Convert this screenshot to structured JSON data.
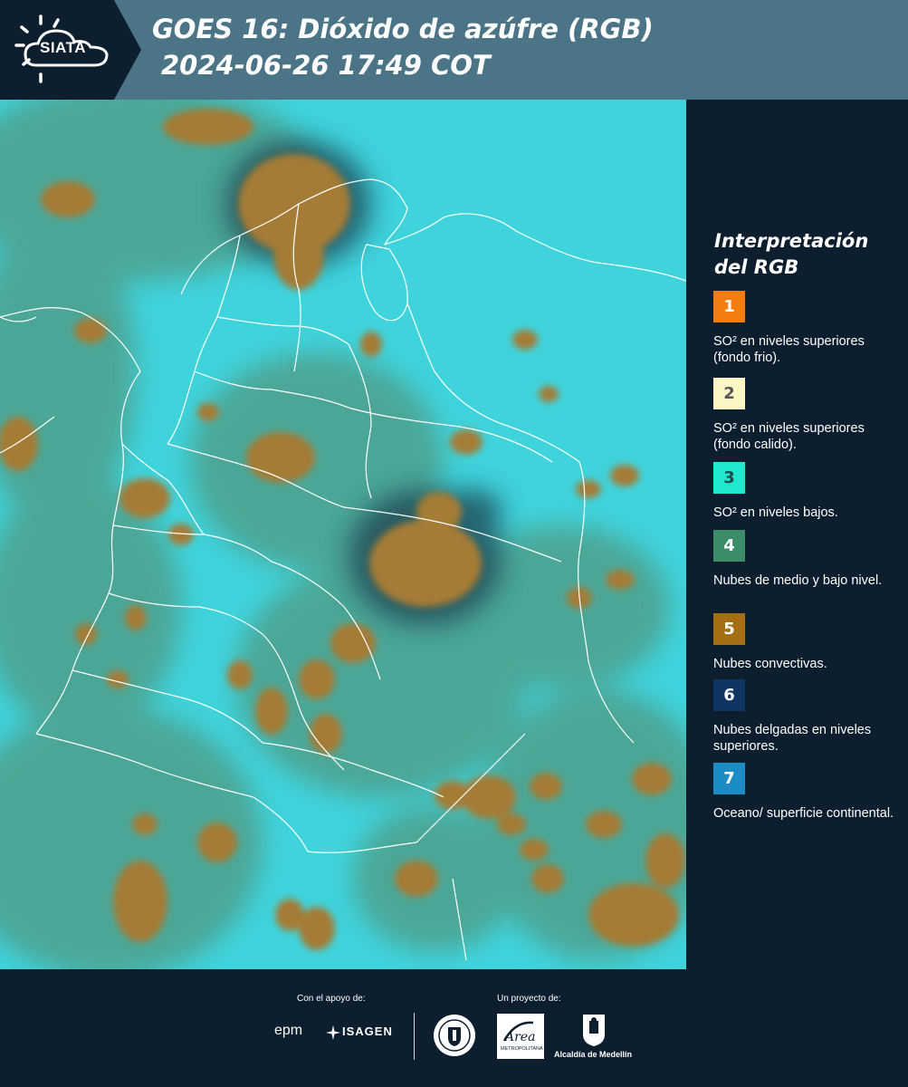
{
  "header": {
    "logo_text": "SIATA",
    "title": "GOES 16: Dióxido de azúfre (RGB)",
    "subtitle": "2024-06-26 17:49 COT"
  },
  "map": {
    "background_color": "#3fd3dc",
    "cloud_color": "#a57b35",
    "border_color": "#ffffff"
  },
  "legend": {
    "title": "Interpretación del RGB",
    "items": [
      {
        "number": "1",
        "color": "#f57c0f",
        "text_color": "#ffffff",
        "label": "SO² en niveles superiores (fondo frio)."
      },
      {
        "number": "2",
        "color": "#fbf6c4",
        "text_color": "#555555",
        "label": "SO² en niveles superiores (fondo calido)."
      },
      {
        "number": "3",
        "color": "#22e7cf",
        "text_color": "#1b4a4a",
        "label": "SO² en niveles bajos."
      },
      {
        "number": "4",
        "color": "#3b8d67",
        "text_color": "#ffffff",
        "label": "Nubes de medio y bajo nivel."
      },
      {
        "number": "5",
        "color": "#a46e12",
        "text_color": "#ffffff",
        "label": "Nubes convectivas."
      },
      {
        "number": "6",
        "color": "#0f3565",
        "text_color": "#ffffff",
        "label": "Nubes delgadas en niveles superiores."
      },
      {
        "number": "7",
        "color": "#1c8cc4",
        "text_color": "#ffffff",
        "label": "Oceano/ superficie continental."
      }
    ]
  },
  "footer": {
    "support_label": "Con el apoyo de:",
    "project_label": "Un proyecto de:",
    "epm_label": "epm",
    "isagen_label": "ISAGEN",
    "area_label": "Área",
    "area_sub": "METROPOLITANA",
    "alcaldia_label": "Alcaldía de Medellín"
  }
}
